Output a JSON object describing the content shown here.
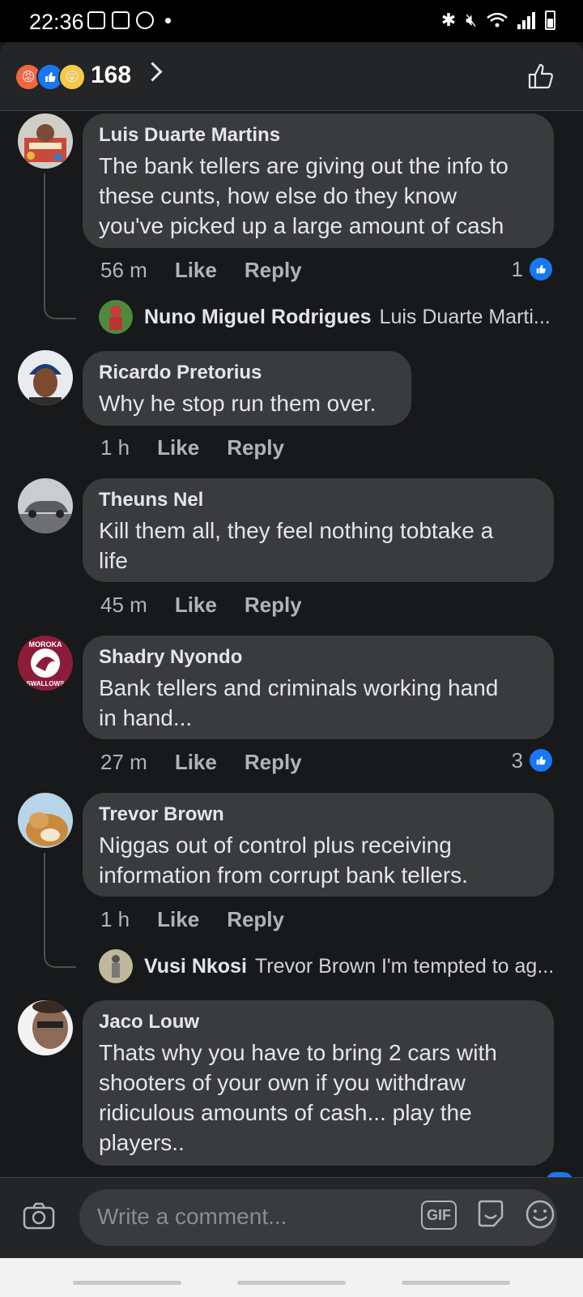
{
  "status_bar": {
    "time": "22:36"
  },
  "header": {
    "reaction_count": "168"
  },
  "comments": [
    {
      "name": "Luis Duarte Martins",
      "lines": [
        "The bank tellers are giving out the info to",
        "these cunts, how else do they know",
        "you've picked up a large amount of cash"
      ],
      "time": "56 m",
      "like": "Like",
      "reply": "Reply",
      "likes": "1",
      "reply_preview": {
        "name": "Nuno Miguel Rodrigues",
        "text": "Luis Duarte Marti..."
      }
    },
    {
      "name": "Ricardo Pretorius",
      "lines": [
        "Why he stop run them over."
      ],
      "time": "1 h",
      "like": "Like",
      "reply": "Reply"
    },
    {
      "name": "Theuns Nel",
      "lines": [
        "Kill them all, they feel nothing tobtake a",
        "life"
      ],
      "time": "45 m",
      "like": "Like",
      "reply": "Reply"
    },
    {
      "name": "Shadry Nyondo",
      "lines": [
        "Bank tellers and criminals working hand",
        "in hand..."
      ],
      "time": "27 m",
      "like": "Like",
      "reply": "Reply",
      "likes": "3",
      "avatar_text": [
        "MOROKA",
        "SWALLOWS"
      ]
    },
    {
      "name": "Trevor Brown",
      "lines": [
        "Niggas out of control plus receiving",
        "information from corrupt bank tellers."
      ],
      "time": "1 h",
      "like": "Like",
      "reply": "Reply",
      "reply_preview": {
        "name": "Vusi Nkosi",
        "text": "Trevor Brown I'm tempted to ag..."
      }
    },
    {
      "name": "Jaco Louw",
      "lines": [
        "Thats why you have to bring 2 cars with",
        "shooters of your own if you withdraw",
        "ridiculous amounts of cash... play the",
        "players.."
      ]
    }
  ],
  "composer": {
    "placeholder": "Write a comment...",
    "gif_label": "GIF"
  },
  "colors": {
    "background": "#18191a",
    "bubble": "#3a3b3c",
    "accent": "#1877f2",
    "muted": "#b0b3b8"
  },
  "icons": [
    "image-icon",
    "parking-icon",
    "messenger-icon",
    "bluetooth-icon",
    "mute-icon",
    "wifi-icon",
    "signal-icon",
    "battery-icon",
    "like-icon",
    "camera-icon",
    "gif-icon",
    "sticker-icon",
    "emoji-icon"
  ]
}
